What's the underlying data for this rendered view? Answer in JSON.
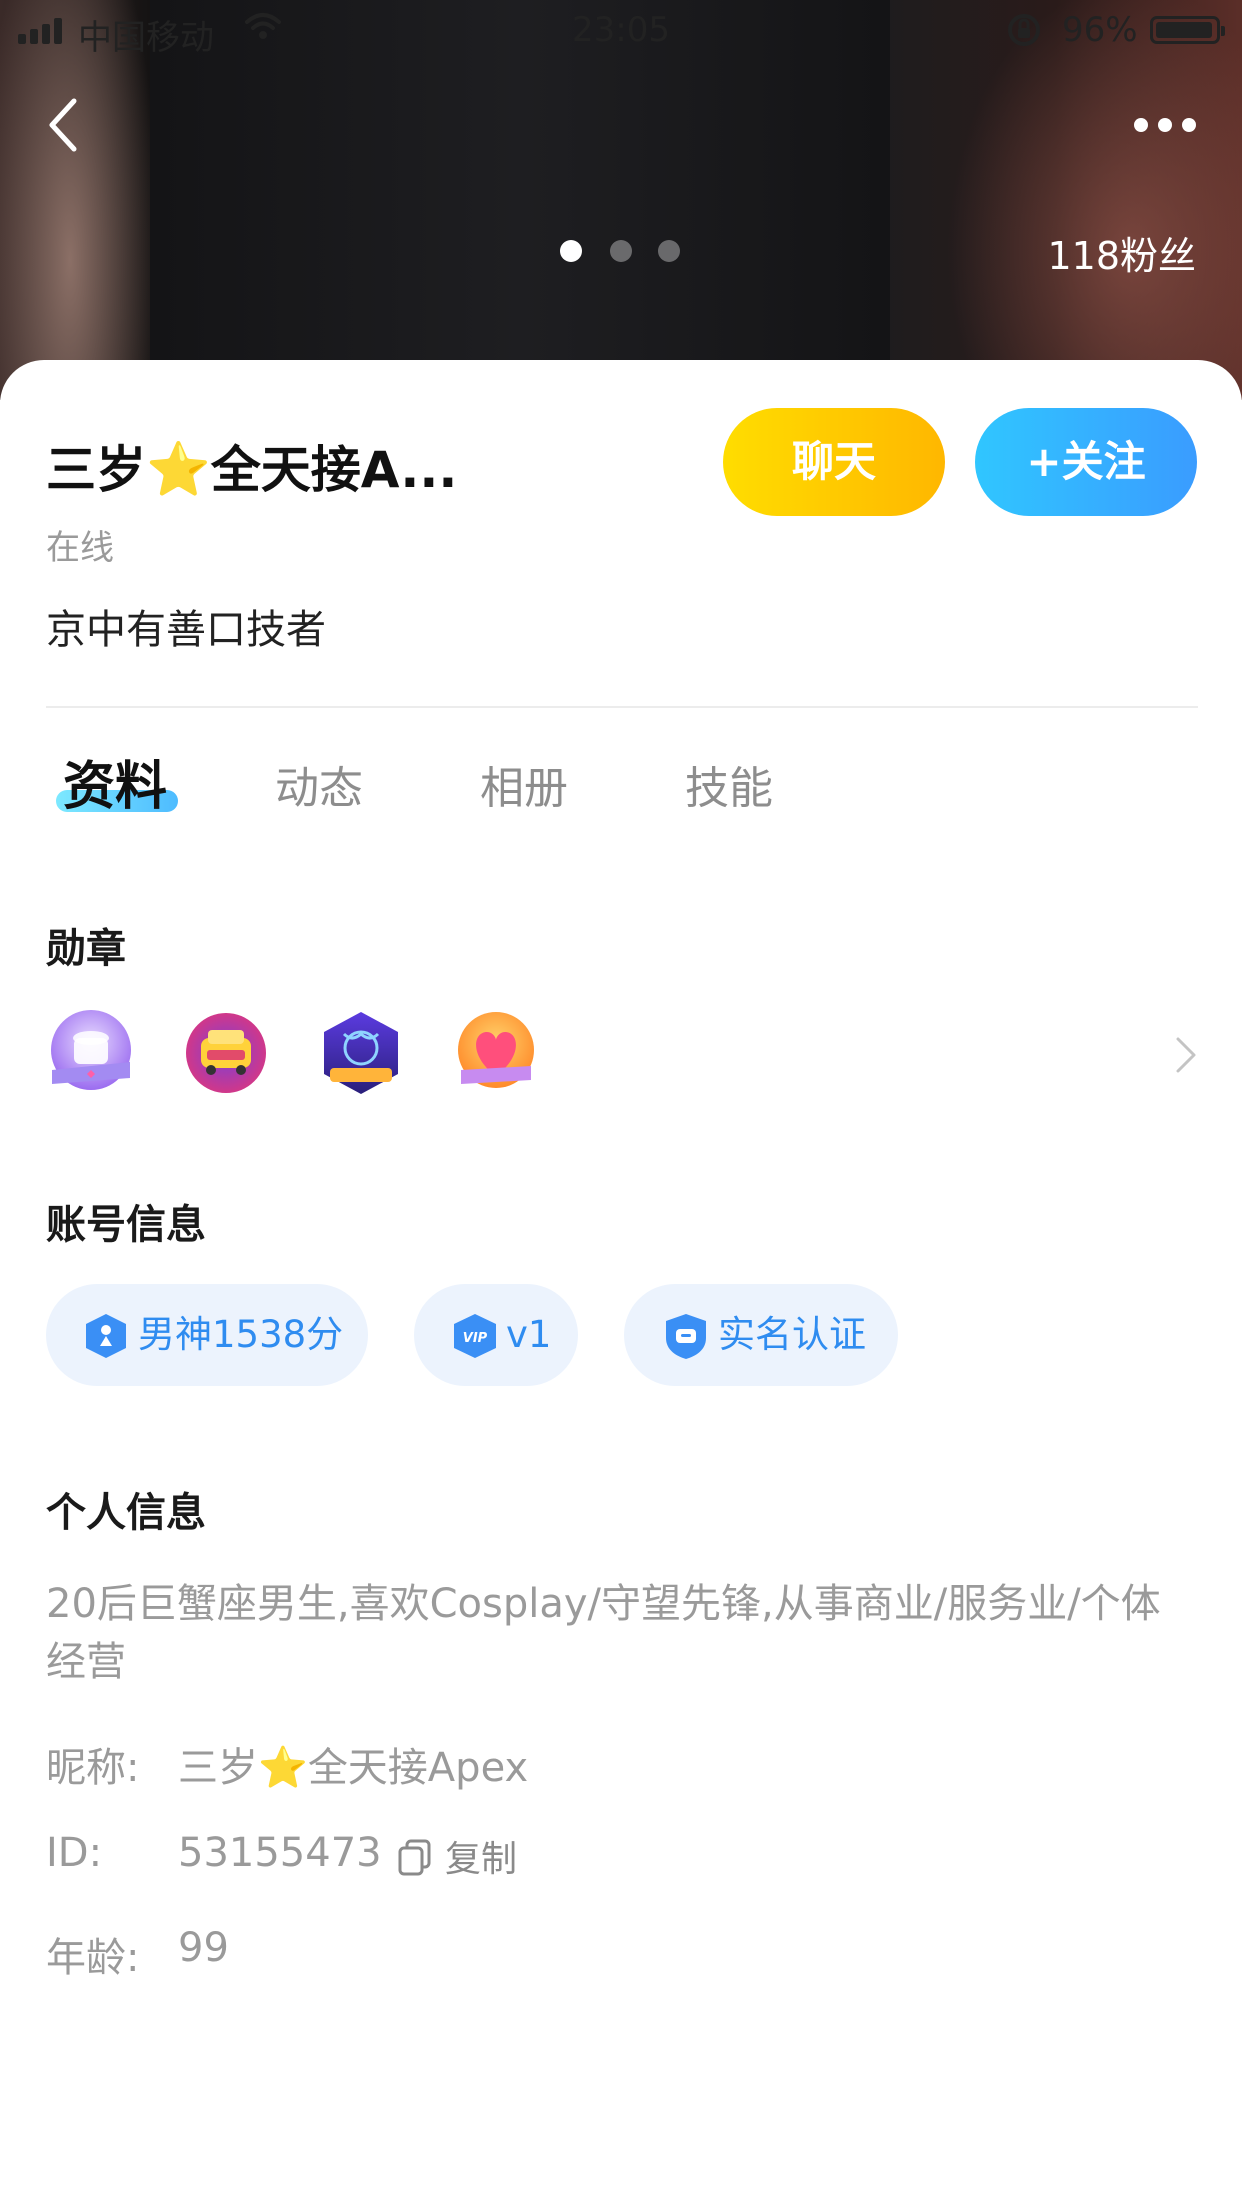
{
  "status_bar": {
    "carrier": "中国移动",
    "time": "23:05",
    "battery": "96%"
  },
  "hero": {
    "fans": "118粉丝",
    "photo_count": 3,
    "photo_active_index": 0
  },
  "profile": {
    "name_part1": "三岁",
    "name_part2": "全天接A...",
    "status": "在线",
    "signature": "京中有善口技者"
  },
  "actions": {
    "chat": "聊天",
    "follow": "+关注"
  },
  "tabs": [
    "资料",
    "动态",
    "相册",
    "技能"
  ],
  "medals": {
    "title": "勋章",
    "items": [
      "coffee-medal-icon",
      "taxi-medal-icon",
      "taurus-medal-icon",
      "heart-medal-icon"
    ]
  },
  "account": {
    "title": "账号信息",
    "badges": [
      "男神1538分",
      "v1",
      "实名认证"
    ],
    "vip_icon_text": "VIP"
  },
  "personal": {
    "title": "个人信息",
    "bio": "20后巨蟹座男生,喜欢Cosplay/守望先锋,从事商业/服务业/个体经营",
    "nickname_label": "昵称:",
    "nickname_part1": "三岁",
    "nickname_part2": "全天接Apex",
    "id_label": "ID:",
    "id_value": "53155473",
    "copy": "复制",
    "age_label": "年龄:",
    "age_value": "99"
  },
  "colors": {
    "chat_gradient": [
      "#ffdd00",
      "#ffb700"
    ],
    "follow_gradient": [
      "#30c6ff",
      "#3a9cff"
    ],
    "pill_bg": "#ecf3fd",
    "pill_text": "#2f8cf0"
  }
}
